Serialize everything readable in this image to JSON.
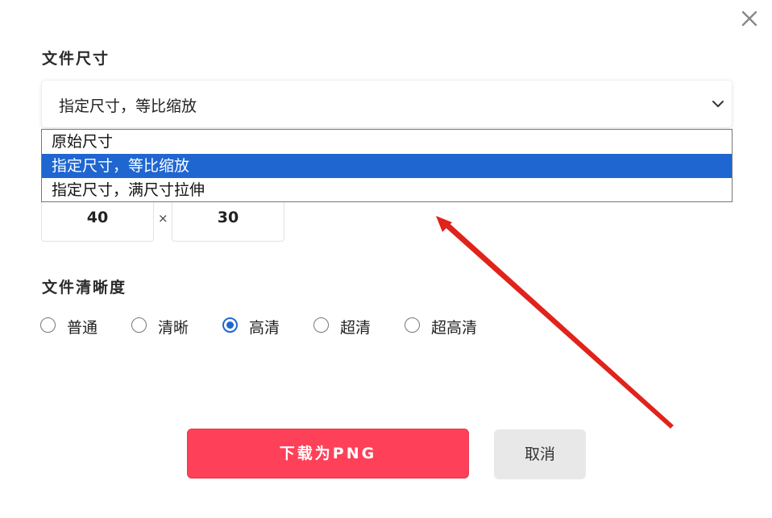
{
  "file_size": {
    "title": "文件尺寸",
    "selected_value": "指定尺寸，等比缩放",
    "options": [
      "原始尺寸",
      "指定尺寸，等比缩放",
      "指定尺寸，满尺寸拉伸"
    ],
    "selected_index": 1,
    "width_value": "40",
    "separator": "×",
    "height_value": "30"
  },
  "clarity": {
    "title": "文件清晰度",
    "options": [
      "普通",
      "清晰",
      "高清",
      "超清",
      "超高清"
    ],
    "selected_index": 2
  },
  "buttons": {
    "download_label": "下载为PNG",
    "cancel_label": "取消"
  },
  "icons": {
    "close": "close-icon",
    "chevron": "chevron-down-icon",
    "annotation_arrow": "red-arrow-annotation"
  },
  "colors": {
    "accent_blue": "#1f66d1",
    "primary_red": "#ff4059",
    "annotation_red": "#e0231b"
  }
}
